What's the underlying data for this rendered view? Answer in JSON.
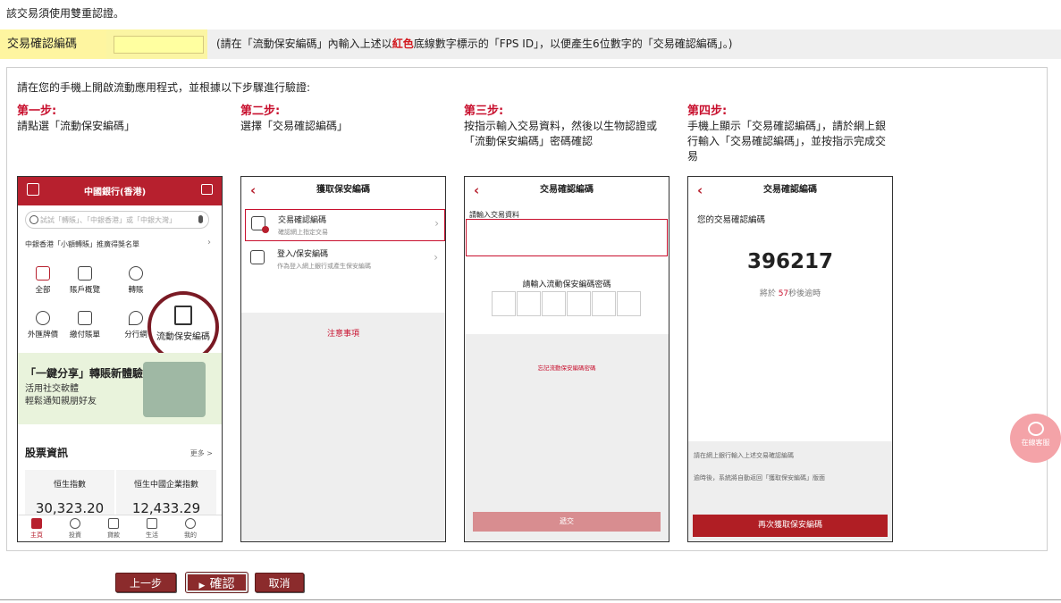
{
  "notice": "該交易須使用雙重認證。",
  "tx": {
    "label": "交易確認編碼",
    "value": "",
    "hint_pre": "(請在「流動保安編碼」內輸入上述以",
    "hint_red": "紅色",
    "hint_post": "底線數字標示的「FPS ID」，以便產生6位數字的「交易確認編碼」。)"
  },
  "intro": "請在您的手機上開啟流動應用程式，並根據以下步驟進行驗證:",
  "steps": [
    {
      "title": "第一步:",
      "text": "請點選「流動保安編碼」"
    },
    {
      "title": "第二步:",
      "text": "選擇「交易確認編碼」"
    },
    {
      "title": "第三步:",
      "text": "按指示輸入交易資料，然後以生物認證或「流動保安編碼」密碼確認"
    },
    {
      "title": "第四步:",
      "text": "手機上顯示「交易確認編碼」，請於網上銀行輸入「交易確認編碼」，並按指示完成交易"
    }
  ],
  "phone1": {
    "logo": "中國銀行(香港)",
    "search": "試試「轉賬」、「中銀香港」或「中銀大灣」",
    "promo": "中銀香港「小額轉賬」推廣得獎名單",
    "tiles": [
      "全部",
      "賬戶概覽",
      "轉賬",
      "外匯牌價",
      "繳付賬單",
      "分行網"
    ],
    "circle": "流動保安編碼",
    "banner_title": "「一鍵分享」轉賬新體驗",
    "banner_l1": "活用社交軟體",
    "banner_l2": "輕鬆通知親朋好友",
    "stock_title": "股票資訊",
    "more": "更多 >",
    "idx1_name": "恒生指數",
    "idx1_val": "30,323.20",
    "idx2_name": "恒生中國企業指數",
    "idx2_val": "12,433.29",
    "nav": [
      "主頁",
      "投資",
      "貸款",
      "生活",
      "我的"
    ]
  },
  "phone2": {
    "title": "獲取保安編碼",
    "item1_title": "交易確認編碼",
    "item1_sub": "確認網上指定交易",
    "item2_title": "登入/保安編碼",
    "item2_sub": "作為登入網上銀行或產生保安編碼",
    "note": "注意事項"
  },
  "phone3": {
    "title": "交易確認編碼",
    "label": "請輸入交易資料",
    "pin_label": "請輸入流動保安編碼密碼",
    "forgot": "忘記流動保安編碼密碼",
    "submit": "遞交"
  },
  "phone4": {
    "title": "交易確認編碼",
    "label": "您的交易確認編碼",
    "code": "396217",
    "exp_pre": "將於",
    "exp_sec": "57",
    "exp_post": "秒後逾時",
    "note1": "請在網上銀行輸入上述交易確認編碼",
    "note2": "逾時後，系統將自動返回「獲取保安編碼」版面",
    "button": "再次獲取保安編碼"
  },
  "chat": "在線客服",
  "buttons": {
    "prev": "上一步",
    "confirm": "確認",
    "cancel": "取消"
  },
  "colors": {
    "accent_red": "#c8102e",
    "button_brown": "#8b2b2c",
    "highlight_yellow": "#fef5a0"
  }
}
